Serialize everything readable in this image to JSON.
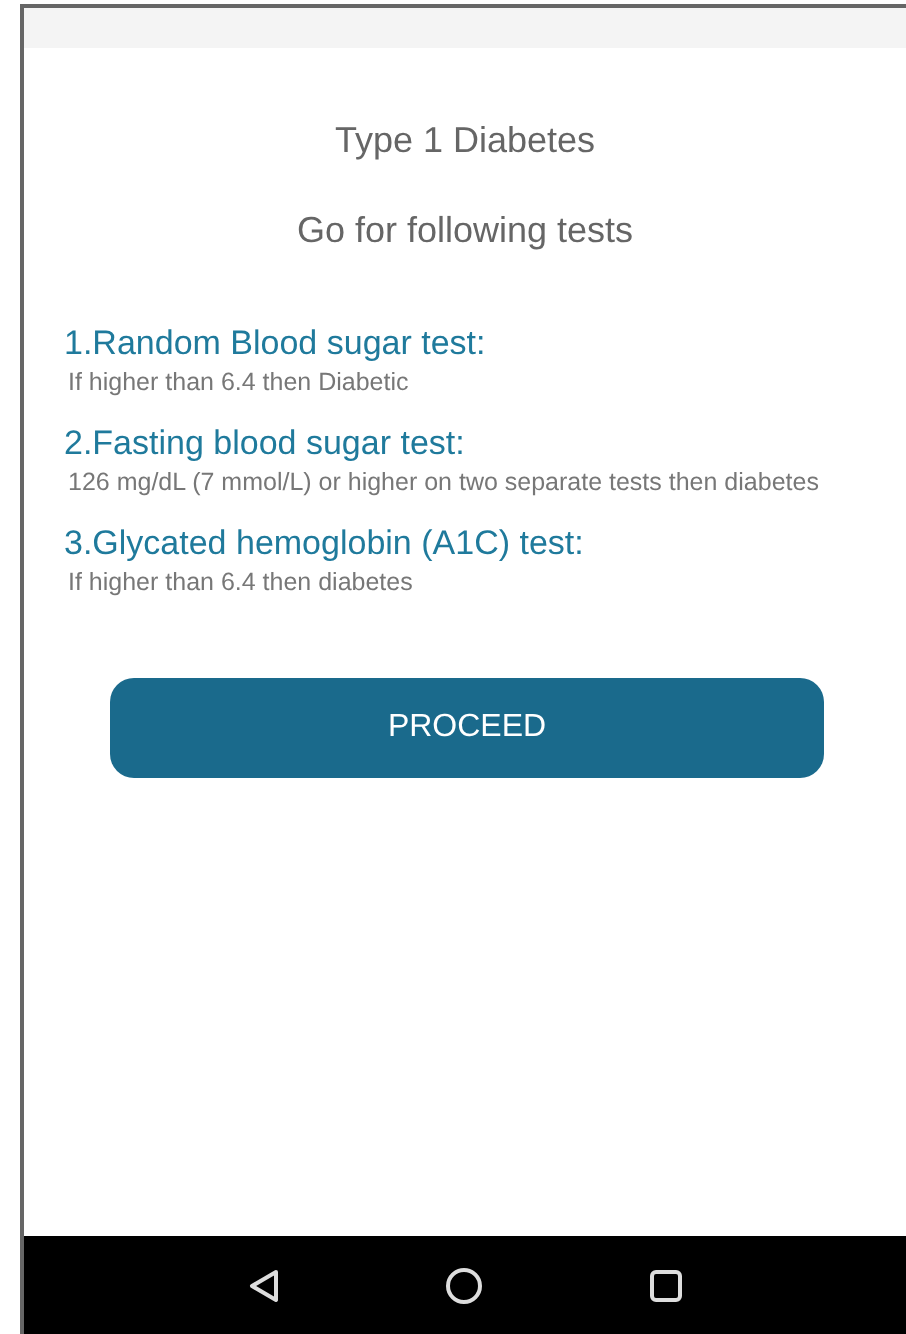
{
  "title": "Type 1 Diabetes",
  "subtitle": "Go for following tests",
  "tests": [
    {
      "heading": "1.Random Blood sugar test:",
      "detail": "If higher than 6.4 then Diabetic"
    },
    {
      "heading": "2.Fasting blood sugar test:",
      "detail": "126 mg/dL (7 mmol/L) or higher on two separate tests then diabetes"
    },
    {
      "heading": "3.Glycated hemoglobin (A1C) test:",
      "detail": "If higher than 6.4 then diabetes"
    }
  ],
  "button": "PROCEED"
}
